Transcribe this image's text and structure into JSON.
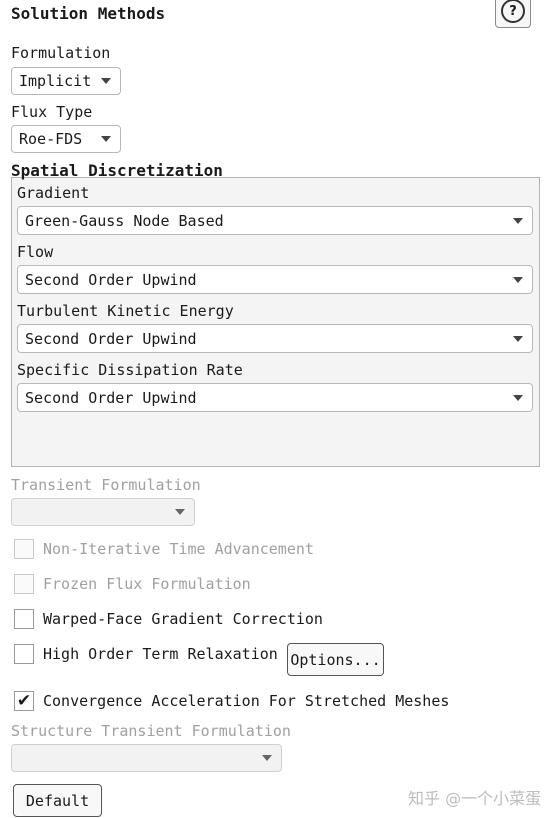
{
  "panel": {
    "title": "Solution Methods",
    "help_glyph": "?"
  },
  "formulation": {
    "label": "Formulation",
    "value": "Implicit"
  },
  "flux_type": {
    "label": "Flux Type",
    "value": "Roe-FDS"
  },
  "spatial": {
    "title": "Spatial Discretization",
    "gradient": {
      "label": "Gradient",
      "value": "Green-Gauss Node Based"
    },
    "flow": {
      "label": "Flow",
      "value": "Second Order Upwind"
    },
    "tke": {
      "label": "Turbulent Kinetic Energy",
      "value": "Second Order Upwind"
    },
    "sdr": {
      "label": "Specific Dissipation Rate",
      "value": "Second Order Upwind"
    }
  },
  "transient": {
    "label": "Transient Formulation",
    "value": ""
  },
  "checkboxes": {
    "non_iterative": {
      "label": "Non-Iterative Time Advancement",
      "checked": false,
      "enabled": false
    },
    "frozen_flux": {
      "label": "Frozen Flux Formulation",
      "checked": false,
      "enabled": false
    },
    "warped_face": {
      "label": "Warped-Face Gradient Correction",
      "checked": false,
      "enabled": true
    },
    "high_order": {
      "label": "High Order Term Relaxation",
      "checked": false,
      "enabled": true
    },
    "convergence": {
      "label": "Convergence Acceleration For Stretched Meshes",
      "checked": true,
      "enabled": true
    }
  },
  "options_button": "Options...",
  "structure_transient": {
    "label": "Structure Transient Formulation",
    "value": ""
  },
  "default_button": "Default",
  "watermark": "知乎 @一个小菜蛋",
  "check_glyph": "✔"
}
